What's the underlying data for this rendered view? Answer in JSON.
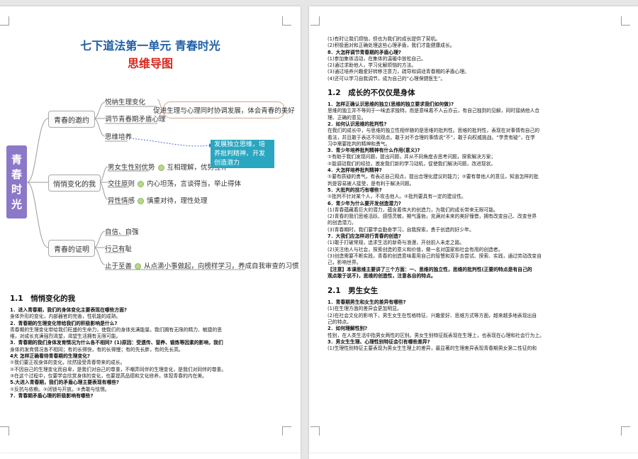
{
  "left_page": {
    "title": "七下道法第一单元 青春时光",
    "subtitle": "思维导图",
    "mindmap": {
      "root": "青春时光",
      "branches": [
        {
          "label": "青春的邀约",
          "leaves": [
            "悦纳生理变化",
            "调节青春期矛盾心理",
            "思维培养"
          ]
        },
        {
          "label": "悄悄变化的我",
          "leaves": [
            "男女生性别优势",
            "交往原则",
            "异性情感"
          ]
        },
        {
          "label": "青春的证明",
          "leaves": [
            "自信、自强",
            "行己有耻",
            "止于至善"
          ]
        }
      ],
      "notes": {
        "bubble": "促进生理与心理同时协调发展，体会青春的美好",
        "callout": "发展独立思维，培养批判精神，开发创造潜力",
        "gender": "互相理解，优势互补",
        "principle": "内心坦荡，言谈得当，举止得体",
        "emotion": "慎重对待，理性处理",
        "excellence": "从点滴小事做起，向榜样学习，养成自我审查的习惯"
      }
    },
    "section_heading": "1.1　悄悄变化的我",
    "lines": [
      {
        "t": "1．进入青春期，我们的身体变化主要表现在哪些方面?",
        "b": true
      },
      {
        "t": "身体外形的变化，内部器官的完善，性机能的成熟。",
        "b": false
      },
      {
        "t": "2．青春期的生理变化带给我们的积极影响是什么?",
        "b": true
      },
      {
        "t": "青春期的生理变化带给我们旺盛的生命力，使我们的身体充满能量。我们拥有无限的精力、敏捷的思",
        "b": false
      },
      {
        "t": "维，对成长充满强烈渴望，渴望生活拥有无限可能。",
        "b": false
      },
      {
        "t": "3．青春期的我们身体发育情况为什么各不相同? (1)原因：受遗传、营养、锻炼等因素的影响，我们",
        "b": true
      },
      {
        "t": "身体的发育情况各不相同；有的长得快，有的长得慢；有的先长胖，有的先长高。",
        "b": false
      },
      {
        "t": "4大 怎样正确看待青春期的生理变化?",
        "b": true
      },
      {
        "t": "①我们要正视身体的变化，欣然接受青春带来的成长。",
        "b": false
      },
      {
        "t": "②不因自己的生理变化而自卑，是我们对自己的尊重，不嘲弄同伴的生理变化，是我们对同伴的尊重。",
        "b": false
      },
      {
        "t": "③在这个过程中，仅要学会欣赏身体的变化，也要提高品德和文化修养，体现青春的内在美。",
        "b": false
      },
      {
        "t": "5.大进入青春期，我们的矛盾心理主要表现有哪些?",
        "b": true
      },
      {
        "t": "①反抗与依赖。②闭锁与开放。③勇敢与怯懦。",
        "b": false
      },
      {
        "t": "7．青春期矛盾心理的积极影响有哪些?",
        "b": true
      }
    ]
  },
  "right_page": {
    "lines_top": [
      {
        "t": "(1)有时让我们烦恼，但也为我们的成长提供了契机。",
        "b": false
      },
      {
        "t": "(2)积极面对和正确处理这些心理矛盾，我们才能健康成长。",
        "b": false
      },
      {
        "t": "8．大怎样调节青春期的矛盾心理?",
        "b": true
      },
      {
        "t": "(1)参加集体活动，在集体的温暖中放松自己。",
        "b": false
      },
      {
        "t": "(2)通过求助他人，学习化解烦恼的方法。",
        "b": false
      },
      {
        "t": "(3)通过培养兴趣爱好转移注意力，疏导和调适青春期的矛盾心理。",
        "b": false
      },
      {
        "t": "(4)还可以学习自我调节，成为自己的“心理保健医生”。",
        "b": false
      }
    ],
    "section_heading_1": "1.2　成长的不仅仅是身体",
    "lines_mid": [
      {
        "t": "1．怎样正确认识思维的独立(思维的独立要求我们如何做)?",
        "b": true
      },
      {
        "t": "思维的独立并不等同于一味追求独特，而是意味着不人云亦云，有自己独到的见解，同时接纳他人合",
        "b": false
      },
      {
        "t": "理、正确的意见。",
        "b": false
      },
      {
        "t": "2．如何认识思维的批判性?",
        "b": true
      },
      {
        "t": "在我们的成长中，与思维的独立性相伴随的是思维的批判性。思维的批判性，表现在对事情有自己的",
        "b": false
      },
      {
        "t": "看法，并且敢于表达不同观点。敢于对不合理的事情说“不”，敢于向权威挑战。“学贵有疑”，在学",
        "b": false
      },
      {
        "t": "习中需要批判的精神和勇气。",
        "b": false
      },
      {
        "t": "3．青少年培养批判精神有什么作用(意义)?",
        "b": true
      },
      {
        "t": "①有助于我们发现问题，提出问题，并从不同角度去思考问题，探索解决方案；",
        "b": false
      },
      {
        "t": "②能调动我们的经验，激发我们新的学习动机，促使我们解决问题，改进现状。",
        "b": false
      },
      {
        "t": "4．大怎样培养批判精神?",
        "b": true
      },
      {
        "t": "①要有质疑的勇气，有表达自己观点，提出合理化建议的能力；②要有尊他人的意见，知道怎样的批",
        "b": false
      },
      {
        "t": "判是容易被人接受，是有利于解决问题。",
        "b": false
      },
      {
        "t": "5．大批判的技巧有哪些?",
        "b": true
      },
      {
        "t": "①批判不针对某个人，不攻击他人。②批判要具有一定的建设性。",
        "b": false
      },
      {
        "t": "6．青少年为什么要开发创造潜力?",
        "b": true
      },
      {
        "t": "(1)青春蕴藏着巨大的潜力，蕴含着伟大的创造力，为我们的成长带来无限可能。",
        "b": false
      },
      {
        "t": "(2)青春的我们思维活跃、感悟灵敏，期气蓬勃，充满对未来的美好憧憬，拥有改变自己、改变世界",
        "b": false
      },
      {
        "t": "的创造潜力。",
        "b": false
      },
      {
        "t": "(3)青春期时，我们要学会勤奋学习，自我探索，勇于创造的好少年。",
        "b": false
      },
      {
        "t": "7．大我们应怎样进行青春的创造?",
        "b": true
      },
      {
        "t": "(1)敢于打破常规，追求生活的新奇与浪漫，开创前人未走之路。",
        "b": false
      },
      {
        "t": "(2)关注他人与社会，探索创造的意义和价值，做一名对国家和社会有用的创造者。",
        "b": false
      },
      {
        "t": "(3)创造需要不断实践，青春的创造意味着用自己的智慧和双手去尝试、探索、实践，通过劳动改变自",
        "b": false
      },
      {
        "t": "己，影响世界。",
        "b": false
      },
      {
        "t": "【注意】本课思维主要讲了三个方面：一、思维的独立性，思维的批判性(正要的特点是有自己的",
        "b": true
      },
      {
        "t": "观点敢于说不)，思维的创造性，注意各自的特点。",
        "b": true
      }
    ],
    "section_heading_2": "2.1　男生女生",
    "lines_bottom": [
      {
        "t": "1．青春期男生和女生的差异有哪些?",
        "b": true
      },
      {
        "t": "(1)在生理方面的差异会更加明显。",
        "b": false
      },
      {
        "t": "(2)在社会文化的影响下，男生女生在性格特征、兴趣爱好、思维方式等方面，越来越多地表现出自",
        "b": false
      },
      {
        "t": "己的特点。",
        "b": false
      },
      {
        "t": "2．如何理解性别?",
        "b": true
      },
      {
        "t": "性别，在人类生活中指男女两性的区别。男女生别特征既表现在生理上，也表现在心理和社会行为上。",
        "b": false
      },
      {
        "t": "3．男女生生理、心理性别特征会引有哪些差异?",
        "b": true
      },
      {
        "t": "(1)生理性别特征主要表现为男女生生理上的差异，最显著的生理差异表现青春期男女第二性征的和",
        "b": false
      }
    ]
  }
}
